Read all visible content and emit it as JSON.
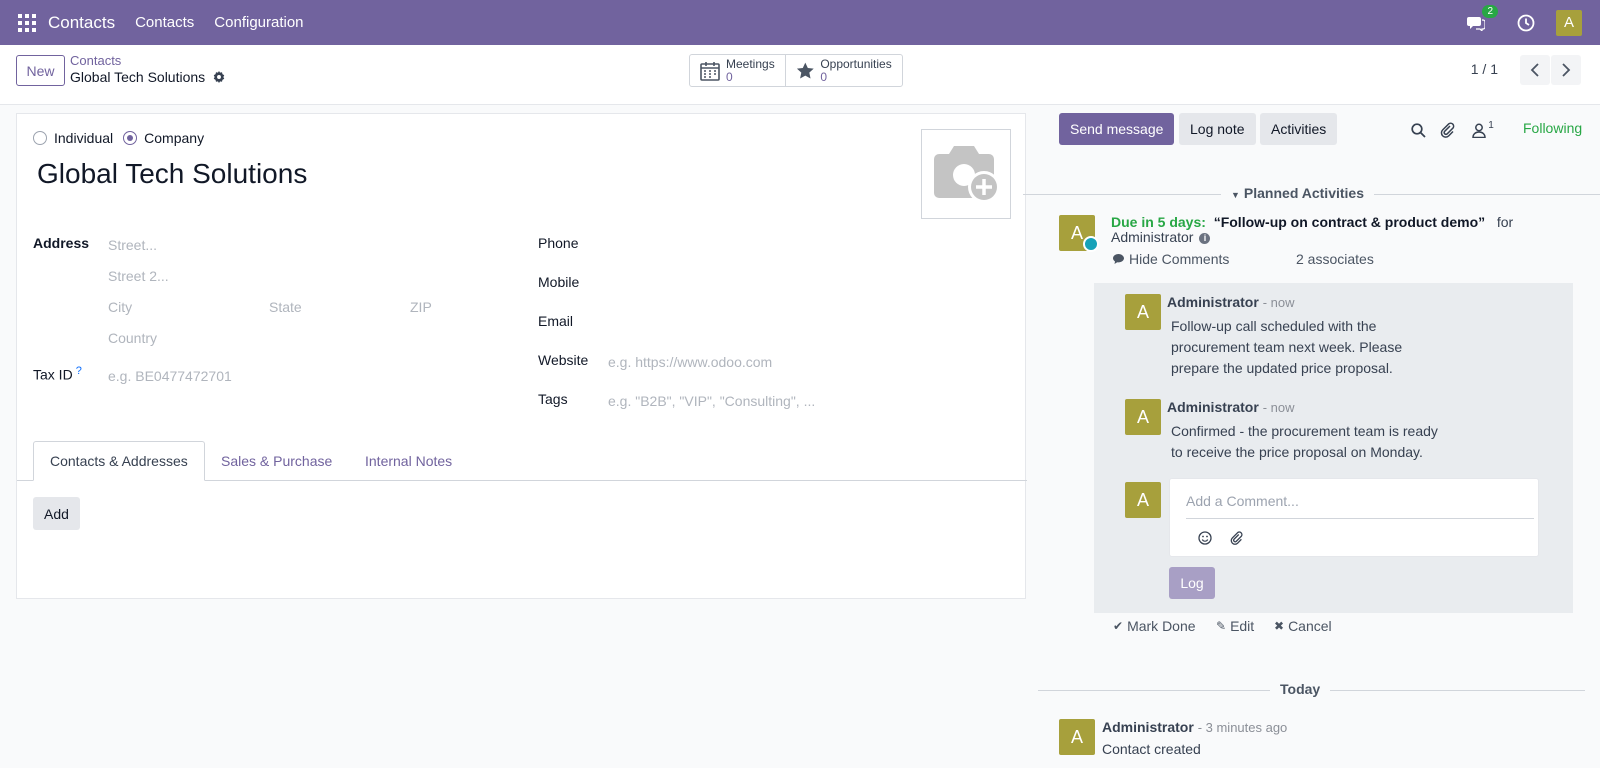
{
  "navbar": {
    "brand": "Contacts",
    "menu": [
      "Contacts",
      "Configuration"
    ],
    "messages_badge": "2",
    "avatar_letter": "A"
  },
  "control_panel": {
    "new_label": "New",
    "breadcrumb_parent": "Contacts",
    "breadcrumb_current": "Global Tech Solutions",
    "smart_buttons": [
      {
        "label": "Meetings",
        "value": "0",
        "icon": "calendar-icon"
      },
      {
        "label": "Opportunities",
        "value": "0",
        "icon": "star-icon"
      }
    ],
    "pager": "1 / 1"
  },
  "form": {
    "type_options": [
      "Individual",
      "Company"
    ],
    "selected_type": "Company",
    "name": "Global Tech Solutions",
    "address_label": "Address",
    "street_placeholder": "Street...",
    "street2_placeholder": "Street 2...",
    "city_placeholder": "City",
    "state_placeholder": "State",
    "zip_placeholder": "ZIP",
    "country_placeholder": "Country",
    "taxid_label": "Tax ID",
    "taxid_help": "?",
    "taxid_placeholder": "e.g. BE0477472701",
    "phone_label": "Phone",
    "mobile_label": "Mobile",
    "email_label": "Email",
    "website_label": "Website",
    "website_placeholder": "e.g. https://www.odoo.com",
    "tags_label": "Tags",
    "tags_placeholder": "e.g. \"B2B\", \"VIP\", \"Consulting\", ...",
    "tabs": [
      "Contacts & Addresses",
      "Sales & Purchase",
      "Internal Notes"
    ],
    "active_tab": "Contacts & Addresses",
    "add_label": "Add"
  },
  "chatter": {
    "send_message": "Send message",
    "log_note": "Log note",
    "activities": "Activities",
    "followers_count": "1",
    "following": "Following",
    "planned_activities": "Planned Activities",
    "activity": {
      "avatar": "A",
      "due_label": "Due in 5 days:",
      "title": "“Follow-up on contract & product demo”",
      "for_text": "for",
      "assignee": "Administrator",
      "hide_comments": "Hide Comments",
      "associates": "2 associates"
    },
    "comments": [
      {
        "avatar": "A",
        "author": "Administrator",
        "time": "- now",
        "lines": [
          "Follow-up call scheduled with the",
          "procurement team next week. Please",
          "prepare the updated price proposal."
        ]
      },
      {
        "avatar": "A",
        "author": "Administrator",
        "time": "- now",
        "lines": [
          "Confirmed - the procurement team is ready",
          "to receive the price proposal on Monday."
        ]
      }
    ],
    "comment_avatar": "A",
    "comment_placeholder": "Add a Comment...",
    "log_label": "Log",
    "activity_actions": [
      "Mark Done",
      "Edit",
      "Cancel"
    ],
    "today_label": "Today",
    "message": {
      "avatar": "A",
      "author": "Administrator",
      "time": "- 3 minutes ago",
      "body": "Contact created"
    }
  },
  "colors": {
    "brand": "#71639e",
    "success": "#28a745",
    "avatar": "#a7a03c"
  }
}
